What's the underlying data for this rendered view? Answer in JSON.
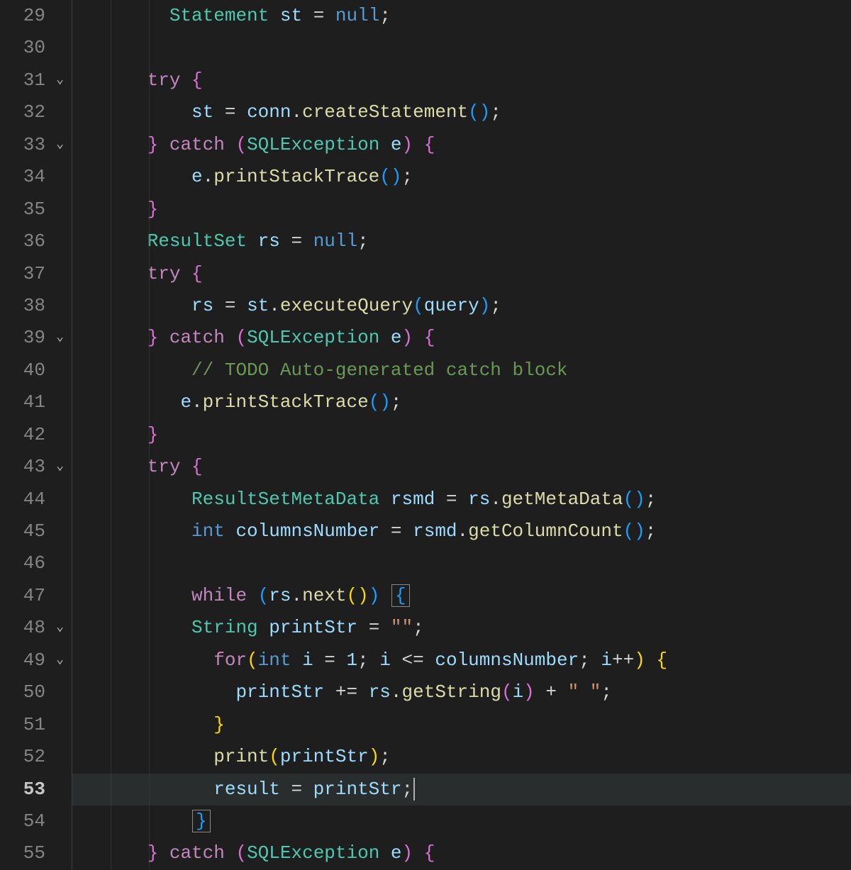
{
  "first_line": 29,
  "active_line": 53,
  "fold_lines": [
    31,
    33,
    39,
    43,
    48,
    49
  ],
  "lines": [
    {
      "n": 29,
      "indent": 8,
      "tokens": [
        [
          "c-type",
          "Statement"
        ],
        [
          "c-pun",
          " "
        ],
        [
          "c-var",
          "st"
        ],
        [
          "c-pun",
          " = "
        ],
        [
          "c-kw",
          "null"
        ],
        [
          "c-pun",
          ";"
        ]
      ]
    },
    {
      "n": 30,
      "indent": 0,
      "tokens": []
    },
    {
      "n": 31,
      "indent": 6,
      "tokens": [
        [
          "c-ctrl",
          "try"
        ],
        [
          "c-pun",
          " "
        ],
        [
          "c-pink",
          "{"
        ]
      ]
    },
    {
      "n": 32,
      "indent": 10,
      "tokens": [
        [
          "c-var",
          "st"
        ],
        [
          "c-pun",
          " = "
        ],
        [
          "c-var",
          "conn"
        ],
        [
          "c-pun",
          "."
        ],
        [
          "c-fn",
          "createStatement"
        ],
        [
          "c-blue",
          "("
        ],
        [
          "c-blue",
          ")"
        ],
        [
          "c-pun",
          ";"
        ]
      ]
    },
    {
      "n": 33,
      "indent": 6,
      "tokens": [
        [
          "c-pink",
          "}"
        ],
        [
          "c-pun",
          " "
        ],
        [
          "c-ctrl",
          "catch"
        ],
        [
          "c-pun",
          " "
        ],
        [
          "c-pink",
          "("
        ],
        [
          "c-type",
          "SQLException"
        ],
        [
          "c-pun",
          " "
        ],
        [
          "c-var",
          "e"
        ],
        [
          "c-pink",
          ")"
        ],
        [
          "c-pun",
          " "
        ],
        [
          "c-pink",
          "{"
        ]
      ]
    },
    {
      "n": 34,
      "indent": 10,
      "tokens": [
        [
          "c-var",
          "e"
        ],
        [
          "c-pun",
          "."
        ],
        [
          "c-fn",
          "printStackTrace"
        ],
        [
          "c-blue",
          "("
        ],
        [
          "c-blue",
          ")"
        ],
        [
          "c-pun",
          ";"
        ]
      ]
    },
    {
      "n": 35,
      "indent": 6,
      "tokens": [
        [
          "c-pink",
          "}"
        ]
      ]
    },
    {
      "n": 36,
      "indent": 6,
      "tokens": [
        [
          "c-type",
          "ResultSet"
        ],
        [
          "c-pun",
          " "
        ],
        [
          "c-var",
          "rs"
        ],
        [
          "c-pun",
          " = "
        ],
        [
          "c-kw",
          "null"
        ],
        [
          "c-pun",
          ";"
        ]
      ]
    },
    {
      "n": 37,
      "indent": 6,
      "tokens": [
        [
          "c-ctrl",
          "try"
        ],
        [
          "c-pun",
          " "
        ],
        [
          "c-pink",
          "{"
        ]
      ]
    },
    {
      "n": 38,
      "indent": 10,
      "tokens": [
        [
          "c-var",
          "rs"
        ],
        [
          "c-pun",
          " = "
        ],
        [
          "c-var",
          "st"
        ],
        [
          "c-pun",
          "."
        ],
        [
          "c-fn",
          "executeQuery"
        ],
        [
          "c-blue",
          "("
        ],
        [
          "c-var",
          "query"
        ],
        [
          "c-blue",
          ")"
        ],
        [
          "c-pun",
          ";"
        ]
      ]
    },
    {
      "n": 39,
      "indent": 6,
      "tokens": [
        [
          "c-pink",
          "}"
        ],
        [
          "c-pun",
          " "
        ],
        [
          "c-ctrl",
          "catch"
        ],
        [
          "c-pun",
          " "
        ],
        [
          "c-pink",
          "("
        ],
        [
          "c-type",
          "SQLException"
        ],
        [
          "c-pun",
          " "
        ],
        [
          "c-var",
          "e"
        ],
        [
          "c-pink",
          ")"
        ],
        [
          "c-pun",
          " "
        ],
        [
          "c-pink",
          "{"
        ]
      ]
    },
    {
      "n": 40,
      "indent": 10,
      "tokens": [
        [
          "c-cmt",
          "// TODO Auto-generated catch block"
        ]
      ]
    },
    {
      "n": 41,
      "indent": 9,
      "tokens": [
        [
          "c-var",
          "e"
        ],
        [
          "c-pun",
          "."
        ],
        [
          "c-fn",
          "printStackTrace"
        ],
        [
          "c-blue",
          "("
        ],
        [
          "c-blue",
          ")"
        ],
        [
          "c-pun",
          ";"
        ]
      ]
    },
    {
      "n": 42,
      "indent": 6,
      "tokens": [
        [
          "c-pink",
          "}"
        ]
      ]
    },
    {
      "n": 43,
      "indent": 6,
      "tokens": [
        [
          "c-ctrl",
          "try"
        ],
        [
          "c-pun",
          " "
        ],
        [
          "c-pink",
          "{"
        ]
      ]
    },
    {
      "n": 44,
      "indent": 10,
      "tokens": [
        [
          "c-type",
          "ResultSetMetaData"
        ],
        [
          "c-pun",
          " "
        ],
        [
          "c-var",
          "rsmd"
        ],
        [
          "c-pun",
          " = "
        ],
        [
          "c-var",
          "rs"
        ],
        [
          "c-pun",
          "."
        ],
        [
          "c-fn",
          "getMetaData"
        ],
        [
          "c-blue",
          "("
        ],
        [
          "c-blue",
          ")"
        ],
        [
          "c-pun",
          ";"
        ]
      ]
    },
    {
      "n": 45,
      "indent": 10,
      "tokens": [
        [
          "c-kw",
          "int"
        ],
        [
          "c-pun",
          " "
        ],
        [
          "c-var",
          "columnsNumber"
        ],
        [
          "c-pun",
          " = "
        ],
        [
          "c-var",
          "rsmd"
        ],
        [
          "c-pun",
          "."
        ],
        [
          "c-fn",
          "getColumnCount"
        ],
        [
          "c-blue",
          "("
        ],
        [
          "c-blue",
          ")"
        ],
        [
          "c-pun",
          ";"
        ]
      ]
    },
    {
      "n": 46,
      "indent": 0,
      "tokens": []
    },
    {
      "n": 47,
      "indent": 10,
      "tokens": [
        [
          "c-ctrl",
          "while"
        ],
        [
          "c-pun",
          " "
        ],
        [
          "c-blue",
          "("
        ],
        [
          "c-var",
          "rs"
        ],
        [
          "c-pun",
          "."
        ],
        [
          "c-fn",
          "next"
        ],
        [
          "c-gold",
          "("
        ],
        [
          "c-gold",
          ")"
        ],
        [
          "c-blue",
          ")"
        ],
        [
          "c-pun",
          " "
        ],
        [
          "box",
          "{"
        ]
      ]
    },
    {
      "n": 48,
      "indent": 10,
      "tokens": [
        [
          "c-type",
          "String"
        ],
        [
          "c-pun",
          " "
        ],
        [
          "c-var",
          "printStr"
        ],
        [
          "c-pun",
          " = "
        ],
        [
          "c-str",
          "\"\""
        ],
        [
          "c-pun",
          ";"
        ]
      ]
    },
    {
      "n": 49,
      "indent": 12,
      "tokens": [
        [
          "c-ctrl",
          "for"
        ],
        [
          "c-gold",
          "("
        ],
        [
          "c-kw",
          "int"
        ],
        [
          "c-pun",
          " "
        ],
        [
          "c-var",
          "i"
        ],
        [
          "c-pun",
          " = "
        ],
        [
          "c-var",
          "1"
        ],
        [
          "c-pun",
          "; "
        ],
        [
          "c-var",
          "i"
        ],
        [
          "c-pun",
          " <= "
        ],
        [
          "c-var",
          "columnsNumber"
        ],
        [
          "c-pun",
          "; "
        ],
        [
          "c-var",
          "i"
        ],
        [
          "c-pun",
          "++"
        ],
        [
          "c-gold",
          ")"
        ],
        [
          "c-pun",
          " "
        ],
        [
          "c-gold",
          "{"
        ]
      ]
    },
    {
      "n": 50,
      "indent": 14,
      "tokens": [
        [
          "c-var",
          "printStr"
        ],
        [
          "c-pun",
          " += "
        ],
        [
          "c-var",
          "rs"
        ],
        [
          "c-pun",
          "."
        ],
        [
          "c-fn",
          "getString"
        ],
        [
          "c-pink",
          "("
        ],
        [
          "c-var",
          "i"
        ],
        [
          "c-pink",
          ")"
        ],
        [
          "c-pun",
          " + "
        ],
        [
          "c-str",
          "\" \""
        ],
        [
          "c-pun",
          ";"
        ]
      ]
    },
    {
      "n": 51,
      "indent": 12,
      "tokens": [
        [
          "c-gold",
          "}"
        ]
      ]
    },
    {
      "n": 52,
      "indent": 12,
      "tokens": [
        [
          "c-fn",
          "print"
        ],
        [
          "c-gold",
          "("
        ],
        [
          "c-var",
          "printStr"
        ],
        [
          "c-gold",
          ")"
        ],
        [
          "c-pun",
          ";"
        ]
      ]
    },
    {
      "n": 53,
      "indent": 12,
      "tokens": [
        [
          "c-var",
          "result"
        ],
        [
          "c-pun",
          " = "
        ],
        [
          "c-var",
          "printStr"
        ],
        [
          "c-pun",
          ";"
        ],
        [
          "cursor",
          ""
        ]
      ]
    },
    {
      "n": 54,
      "indent": 10,
      "tokens": [
        [
          "box",
          "}"
        ]
      ]
    },
    {
      "n": 55,
      "indent": 6,
      "tokens": [
        [
          "c-pink",
          "}"
        ],
        [
          "c-pun",
          " "
        ],
        [
          "c-ctrl",
          "catch"
        ],
        [
          "c-pun",
          " "
        ],
        [
          "c-pink",
          "("
        ],
        [
          "c-type",
          "SQLException"
        ],
        [
          "c-pun",
          " "
        ],
        [
          "c-var",
          "e"
        ],
        [
          "c-pink",
          ")"
        ],
        [
          "c-pun",
          " "
        ],
        [
          "c-pink",
          "{"
        ]
      ]
    }
  ]
}
